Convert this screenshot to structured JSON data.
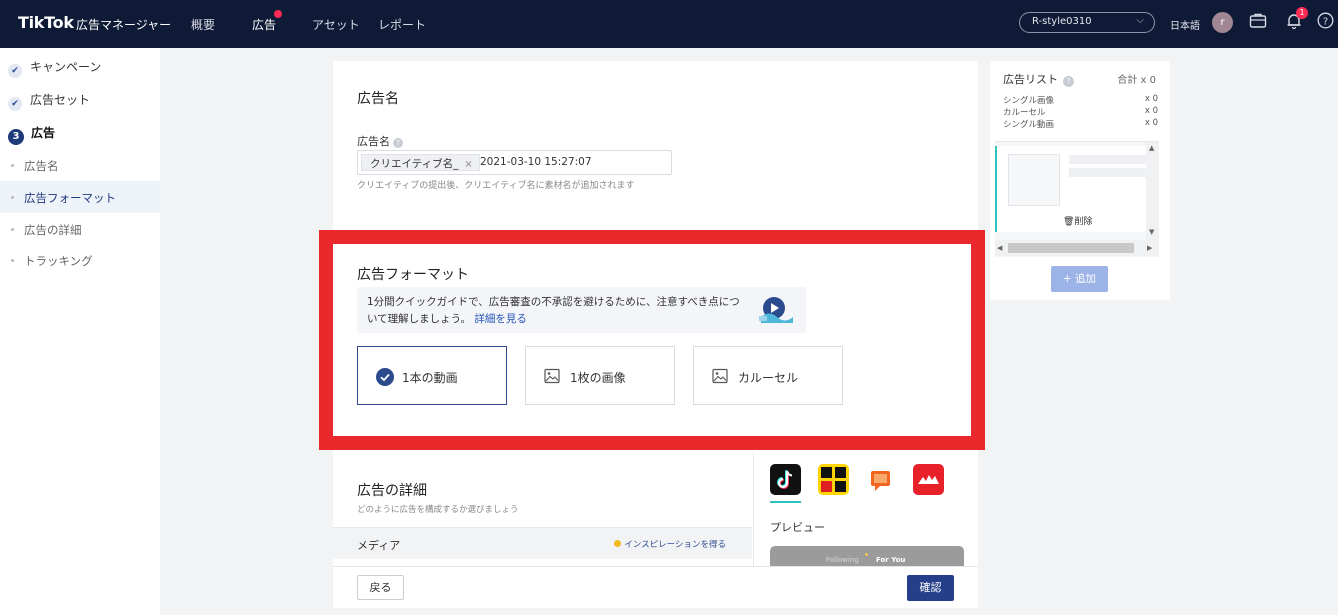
{
  "topbar": {
    "logo": "TikTok",
    "subtitle": "広告マネージャー",
    "nav": [
      "概要",
      "広告",
      "アセット",
      "レポート"
    ],
    "account": "R-style0310",
    "language": "日本語",
    "avatar_initial": "r",
    "notification_count": "1",
    "help_glyph": "?"
  },
  "sidebar": {
    "steps": [
      "キャンペーン",
      "広告セット",
      "広告"
    ],
    "current_step_number": "3",
    "sub_items": [
      "広告名",
      "広告フォーマット",
      "広告の詳細",
      "トラッキング"
    ]
  },
  "ad_name": {
    "section_title": "広告名",
    "field_label": "広告名",
    "tag": "クリエイティブ名_",
    "tag_remove": "×",
    "value": "2021-03-10 15:27:07",
    "hint": "クリエイティブの提出後、クリエイティブ名に素材名が追加されます"
  },
  "ad_format": {
    "section_title": "広告フォーマット",
    "guide_text": "1分間クイックガイドで、広告審査の不承認を避けるために、注意すべき点について理解しましょう。",
    "guide_link": "詳細を見る",
    "options": [
      "1本の動画",
      "1枚の画像",
      "カルーセル"
    ],
    "selected": "1本の動画"
  },
  "ad_details": {
    "section_title": "広告の詳細",
    "subtitle": "どのように広告を構成するか選びましょう",
    "media_label": "メディア",
    "inspiration_link": "インスピレーションを得る"
  },
  "preview": {
    "title": "プレビュー",
    "phone_tabs": [
      "Following",
      "For You"
    ]
  },
  "footer": {
    "back": "戻る",
    "confirm": "確認"
  },
  "ad_list": {
    "title": "広告リスト",
    "total": "合計 x 0",
    "rows": [
      {
        "label": "シングル画像",
        "count": "x 0"
      },
      {
        "label": "カルーセル",
        "count": "x 0"
      },
      {
        "label": "シングル動画",
        "count": "x 0"
      }
    ],
    "delete": "削除",
    "add": "+ 追加"
  },
  "colors": {
    "topbar": "#0f1a36",
    "accent": "#263f8a",
    "highlight_border": "#e8282a",
    "teal": "#2ec3c0",
    "badge": "#fe2c55"
  }
}
